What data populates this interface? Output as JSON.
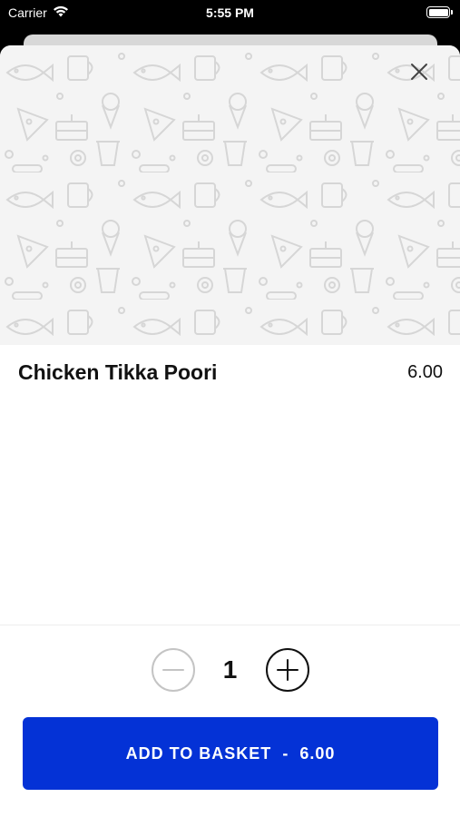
{
  "status_bar": {
    "carrier": "Carrier",
    "time": "5:55 PM",
    "icons": [
      "wifi-icon",
      "battery-icon"
    ]
  },
  "item": {
    "name": "Chicken Tikka Poori",
    "price": "6.00"
  },
  "quantity": {
    "value": "1"
  },
  "add_button": {
    "label": "ADD TO BASKET",
    "separator": "-",
    "total": "6.00"
  },
  "colors": {
    "accent": "#0432d6",
    "hero_background": "#f4f4f4"
  }
}
